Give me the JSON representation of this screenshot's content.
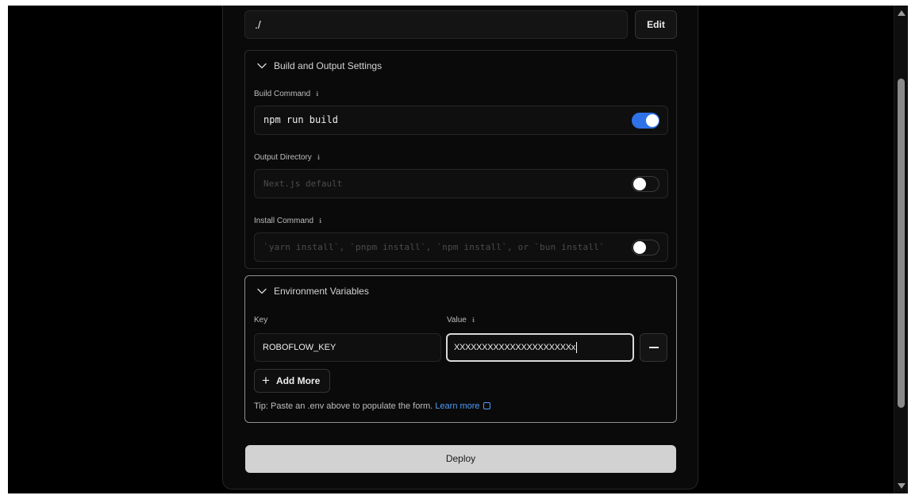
{
  "root_directory": {
    "value": "./",
    "edit_label": "Edit"
  },
  "build_settings": {
    "title": "Build and Output Settings",
    "fields": [
      {
        "label": "Build Command",
        "value": "npm run build",
        "placeholder": "",
        "override_enabled": true
      },
      {
        "label": "Output Directory",
        "value": "",
        "placeholder": "Next.js default",
        "override_enabled": false
      },
      {
        "label": "Install Command",
        "value": "",
        "placeholder": "`yarn install`, `pnpm install`, `npm install`, or `bun install`",
        "override_enabled": false
      }
    ]
  },
  "environment_variables": {
    "title": "Environment Variables",
    "key_label": "Key",
    "value_label": "Value",
    "rows": [
      {
        "key": "ROBOFLOW_KEY",
        "value": "XXXXXXXXXXXXXXXXXXXXXx"
      }
    ],
    "add_more_label": "Add More",
    "tip_text": "Tip: Paste an .env above to populate the form.",
    "learn_more_label": "Learn more"
  },
  "deploy_label": "Deploy",
  "icons": {
    "section_toggle": "chevron-down-icon",
    "info": "info-icon",
    "external": "external-link-icon",
    "add": "plus-icon",
    "remove": "minus-icon"
  },
  "colors": {
    "toggle_on": "#2f72e8",
    "link": "#4f9cf9",
    "deploy_bg": "#d2d2d2"
  }
}
